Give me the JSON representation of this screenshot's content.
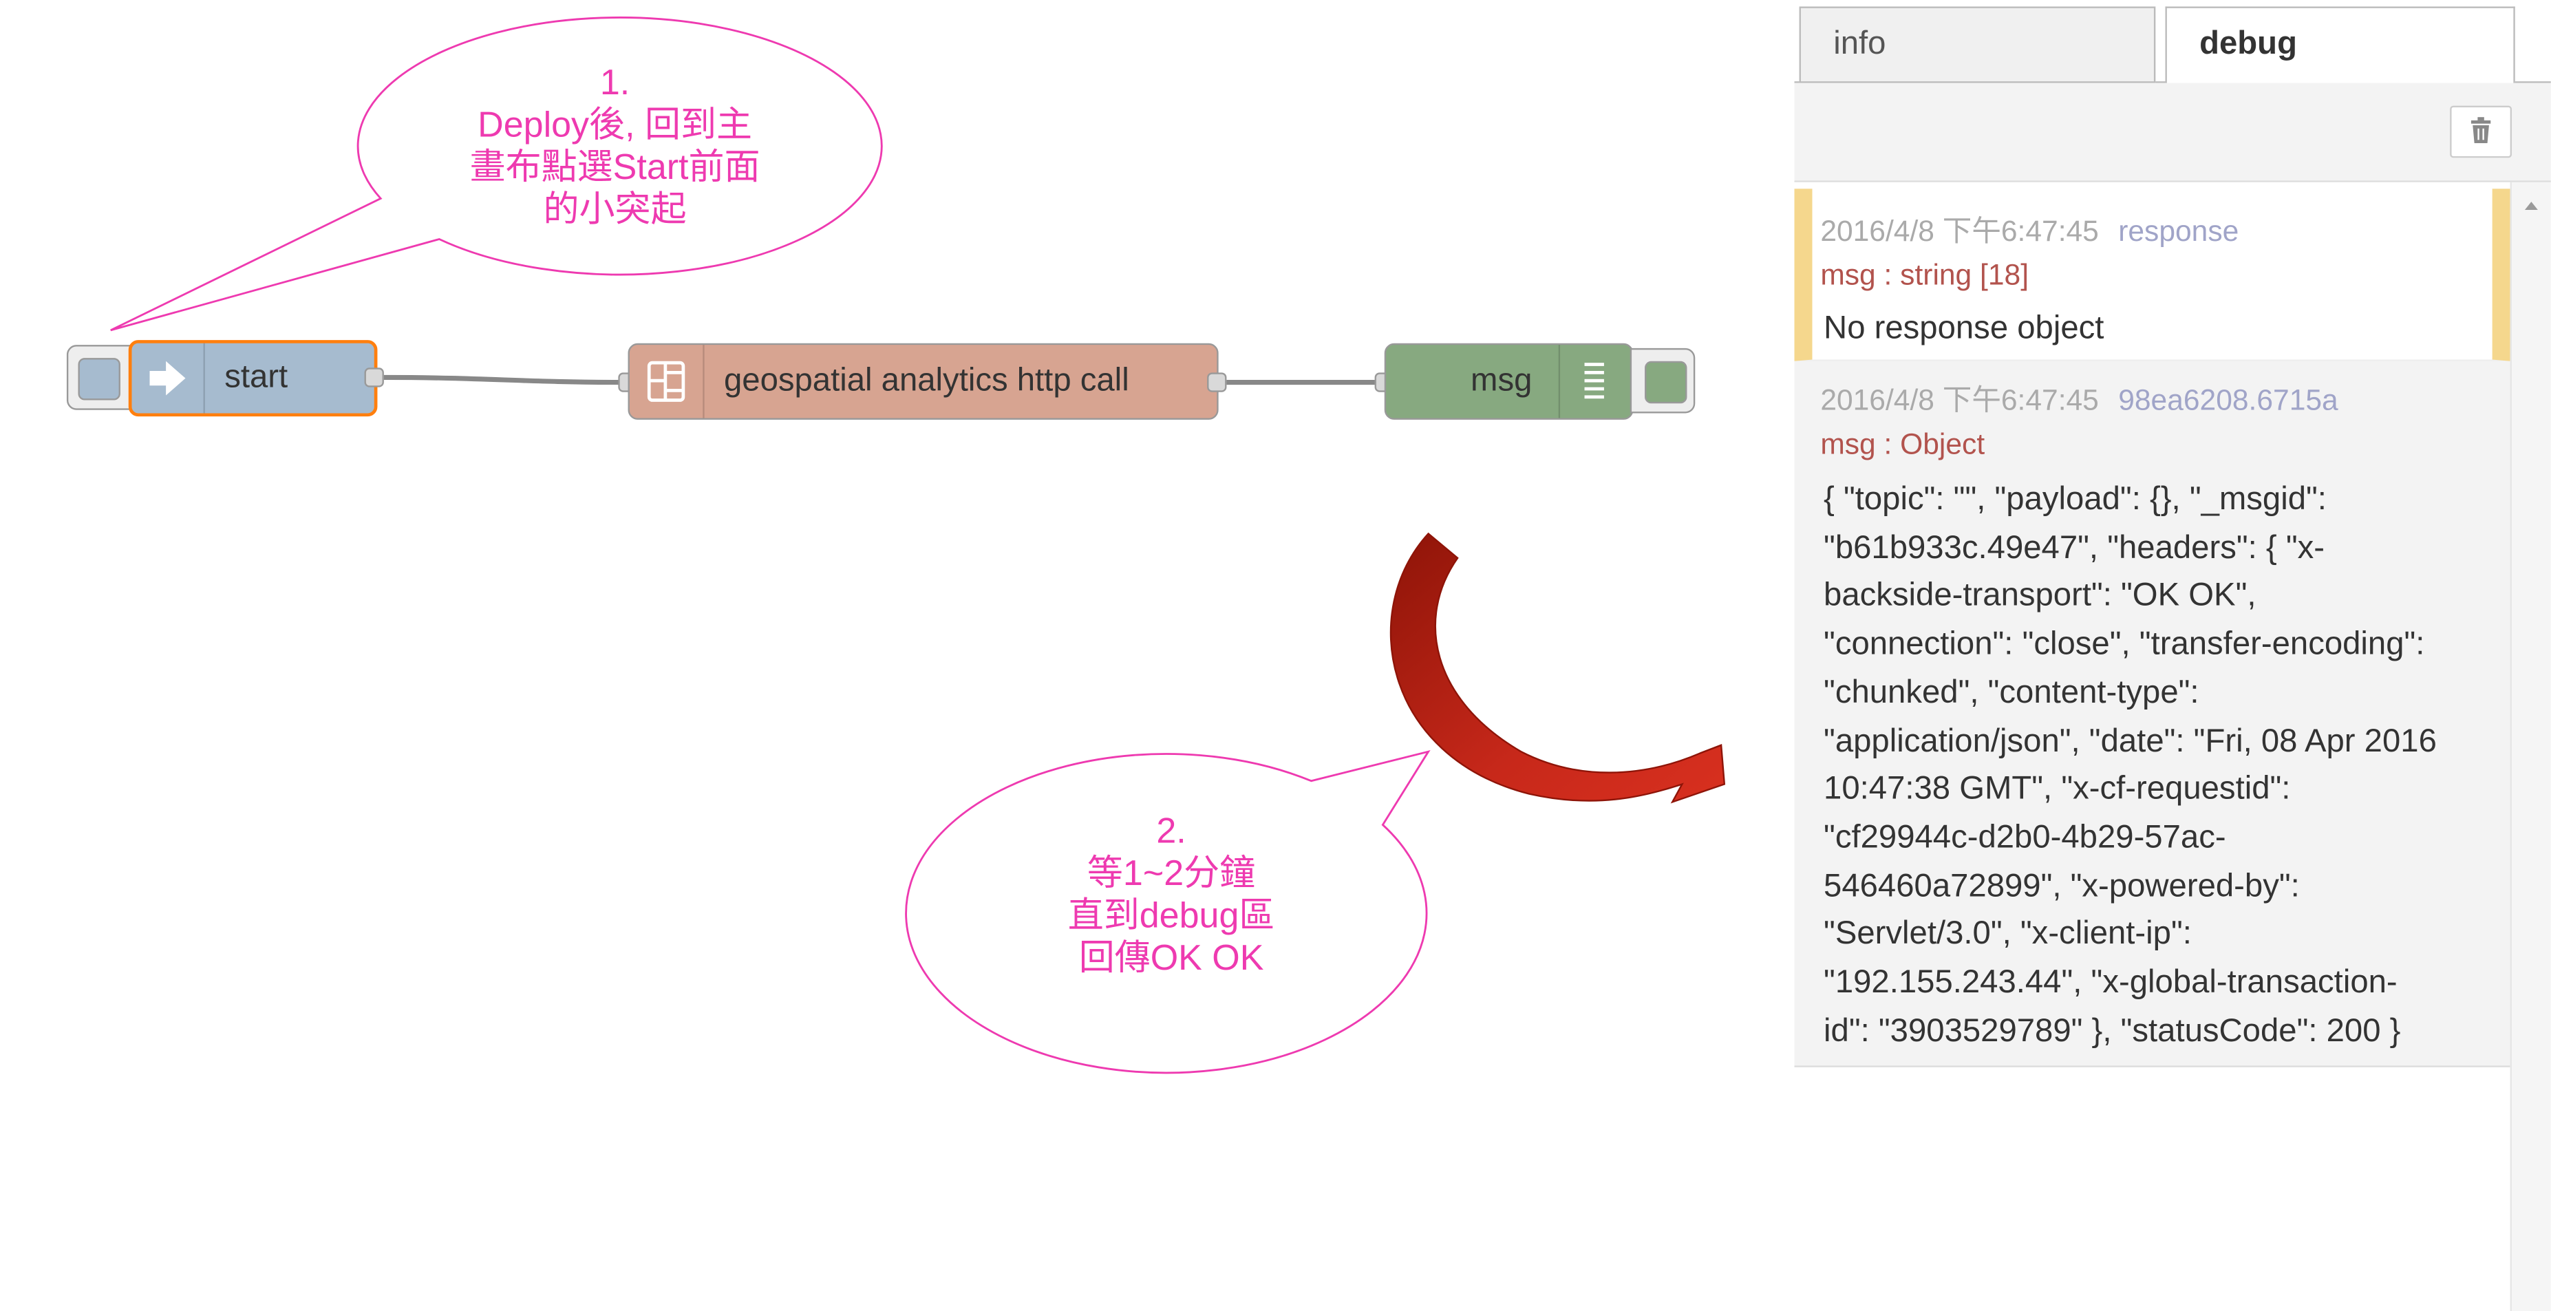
{
  "flow": {
    "nodes": {
      "inject": {
        "label": "start",
        "icon": "arrow-right-icon",
        "color": "#a6bbcf"
      },
      "function": {
        "label": "geospatial analytics http call",
        "icon": "function-icon",
        "color": "#d7a491"
      },
      "debug": {
        "label": "msg",
        "icon": "list-lines-icon",
        "color": "#87a980"
      }
    }
  },
  "annotations": {
    "callout1": {
      "lines": [
        "1.",
        "Deploy後, 回到主",
        "畫布點選Start前面",
        "的小突起"
      ],
      "color": "#ee3ab0"
    },
    "callout2": {
      "lines": [
        "2.",
        "等1~2分鐘",
        "直到debug區",
        "回傳OK OK"
      ],
      "color": "#ee3ab0"
    },
    "arrow": {
      "color": "#b22010"
    }
  },
  "sidebar": {
    "tabs": [
      {
        "label": "info",
        "active": false
      },
      {
        "label": "debug",
        "active": true
      }
    ],
    "clear_icon": "trash-icon",
    "messages": [
      {
        "timestamp": "2016/4/8 下午6:47:45",
        "topic": "response",
        "type": "msg : string [18]",
        "body_lines": [
          "No response object"
        ],
        "highlight": true
      },
      {
        "timestamp": "2016/4/8 下午6:47:45",
        "topic": "98ea6208.6715a",
        "type": "msg : Object",
        "body_lines": [
          "{ \"topic\": \"\", \"payload\": {}, \"_msgid\":",
          "\"b61b933c.49e47\", \"headers\": { \"x-",
          "backside-transport\": \"OK OK\",",
          "\"connection\": \"close\", \"transfer-encoding\":",
          "\"chunked\", \"content-type\":",
          "\"application/json\", \"date\": \"Fri, 08 Apr 2016",
          "10:47:38 GMT\", \"x-cf-requestid\":",
          "\"cf29944c-d2b0-4b29-57ac-",
          "546460a72899\", \"x-powered-by\":",
          "\"Servlet/3.0\", \"x-client-ip\":",
          "\"192.155.243.44\", \"x-global-transaction-",
          "id\": \"3903529789\" }, \"statusCode\": 200 }"
        ],
        "highlight": false
      }
    ]
  }
}
